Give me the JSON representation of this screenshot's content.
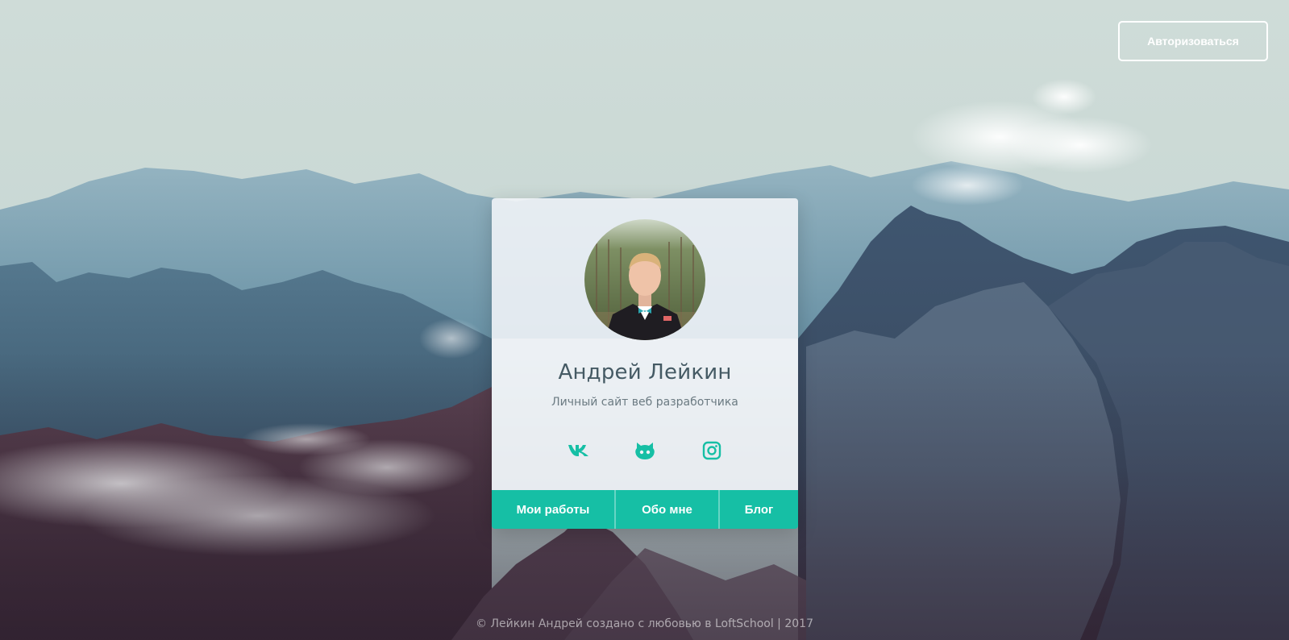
{
  "header": {
    "auth_label": "Авторизоваться"
  },
  "profile": {
    "name": "Андрей Лейкин",
    "subtitle": "Личный сайт веб разработчика"
  },
  "socials": [
    {
      "icon": "vk-icon"
    },
    {
      "icon": "github-icon"
    },
    {
      "icon": "instagram-icon"
    }
  ],
  "nav": {
    "works_label": "Мои работы",
    "about_label": "Обо мне",
    "blog_label": "Блог"
  },
  "footer": {
    "text": "© Лейкин Андрей создано с любовью в LoftSchool | 2017"
  },
  "colors": {
    "accent": "#16bfa5",
    "name_text": "#455a64",
    "subtitle_text": "#6b7a82"
  }
}
